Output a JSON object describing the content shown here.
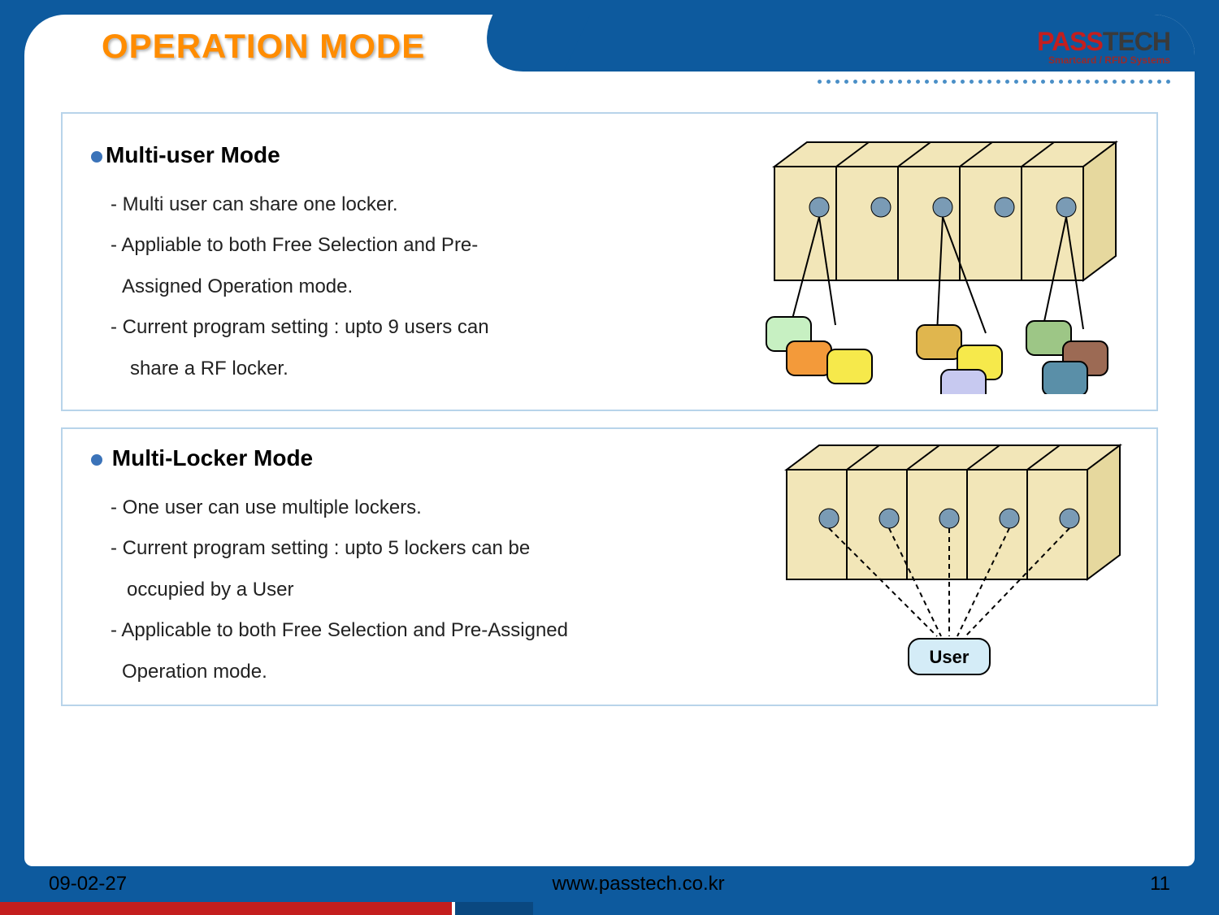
{
  "title": "OPERATION MODE",
  "logo": {
    "prefix": "PASS",
    "suffix": "TECH",
    "tagline": "Smartcard / RFID Systems"
  },
  "section1": {
    "heading": "Multi-user Mode",
    "line1": "- Multi user can share one locker.",
    "line2": "-  Appliable to both Free Selection and Pre-",
    "line3": "Assigned Operation mode.",
    "line4": "- Current program setting : upto 9 users can",
    "line5": "share a RF locker."
  },
  "section2": {
    "heading": " Multi-Locker Mode",
    "line1": "- One user can use multiple lockers.",
    "line2": "- Current program setting : upto 5 lockers can be",
    "line3": "occupied by a  User",
    "line4": "- Applicable to both Free Selection and Pre-Assigned",
    "line5": "Operation mode.",
    "user_label": "User"
  },
  "footer": {
    "date": "09-02-27",
    "url": "www.passtech.co.kr",
    "page": "11"
  }
}
